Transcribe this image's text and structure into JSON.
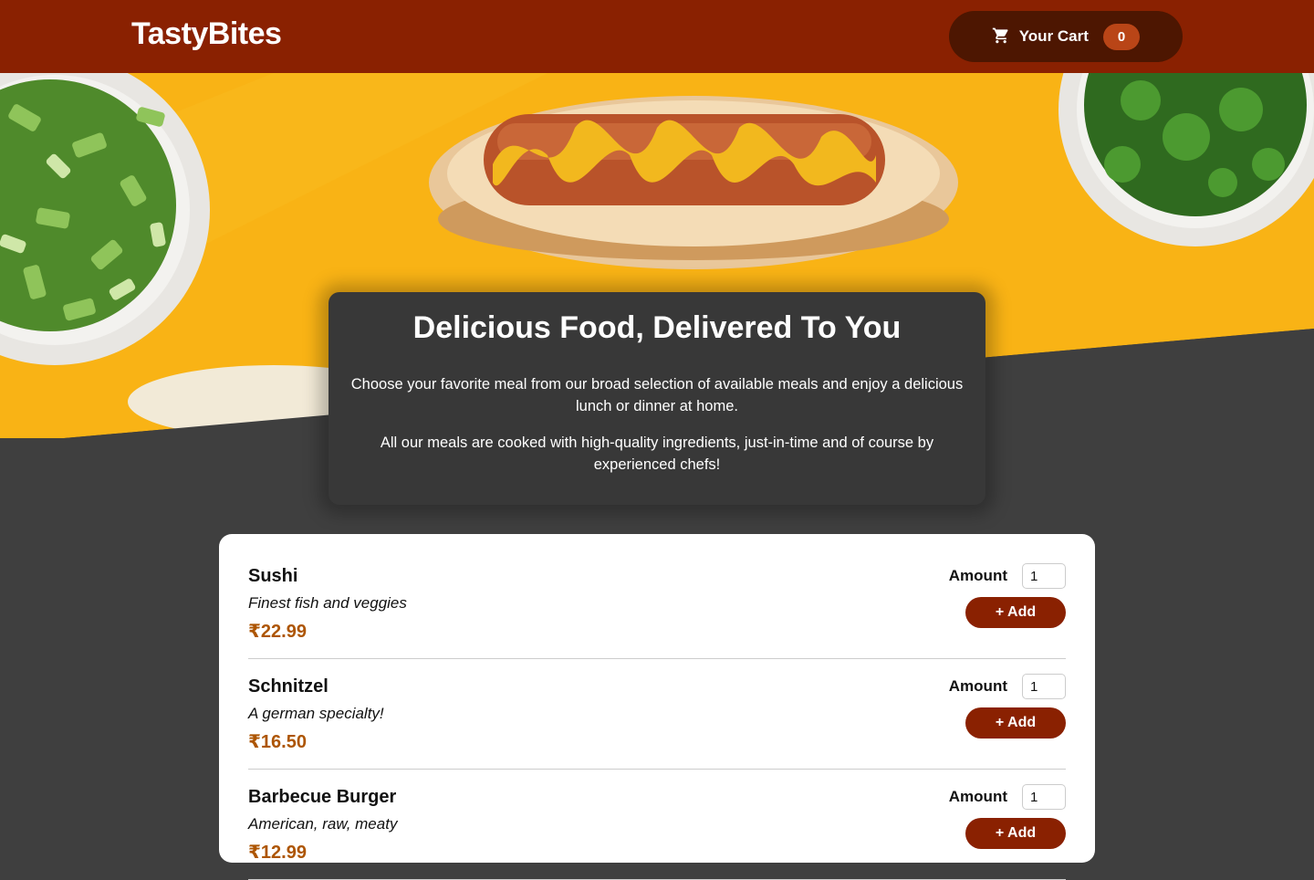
{
  "header": {
    "logo": "TastyBites",
    "cart_label": "Your Cart",
    "cart_count": "0",
    "cart_icon": "shopping-cart-icon"
  },
  "hero": {
    "image": "hot-dog-with-mustard-and-herb-bowls"
  },
  "summary": {
    "title": "Delicious Food, Delivered To You",
    "paragraph1": "Choose your favorite meal from our broad selection of available meals and enjoy a delicious lunch or dinner at home.",
    "paragraph2": "All our meals are cooked with high-quality ingredients, just-in-time and of course by experienced chefs!"
  },
  "meals": [
    {
      "name": "Sushi",
      "description": "Finest fish and veggies",
      "price": "₹22.99",
      "amount_label": "Amount",
      "amount": "1",
      "add_label": "+ Add"
    },
    {
      "name": "Schnitzel",
      "description": "A german specialty!",
      "price": "₹16.50",
      "amount_label": "Amount",
      "amount": "1",
      "add_label": "+ Add"
    },
    {
      "name": "Barbecue Burger",
      "description": "American, raw, meaty",
      "price": "₹12.99",
      "amount_label": "Amount",
      "amount": "1",
      "add_label": "+ Add"
    }
  ],
  "colors": {
    "header": "#8a2101",
    "cart_button": "#4d1601",
    "badge": "#b94517",
    "price": "#ad5502",
    "background": "#3f3f3f"
  }
}
